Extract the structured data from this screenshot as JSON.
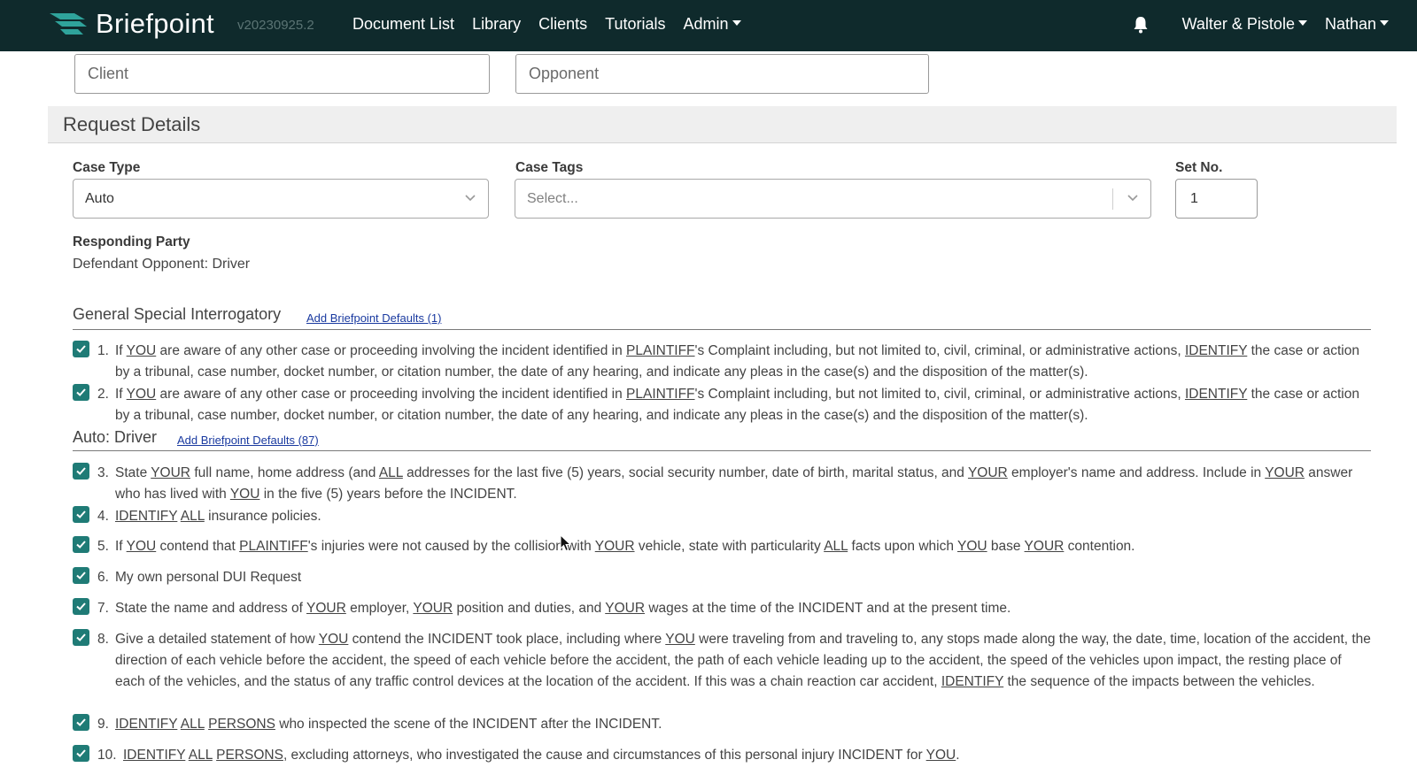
{
  "app": {
    "brand_name": "Briefpoint",
    "version": "v20230925.2",
    "nav_links": [
      "Document List",
      "Library",
      "Clients",
      "Tutorials"
    ],
    "admin_label": "Admin",
    "firm_label": "Walter & Pistole",
    "user_label": "Nathan",
    "accent_color": "#1f7b76",
    "navbar_color": "#0f2a2c"
  },
  "top_fields": {
    "client_placeholder": "Client",
    "opponent_placeholder": "Opponent"
  },
  "request_details": {
    "title": "Request Details",
    "case_type_label": "Case Type",
    "case_type_value": "Auto",
    "case_tags_label": "Case Tags",
    "case_tags_placeholder": "Select...",
    "set_no_label": "Set No.",
    "set_no_value": "1",
    "responding_party_label": "Responding Party",
    "responding_party_value": "Defendant Opponent: Driver"
  },
  "groups": [
    {
      "heading": "General Special Interrogatory",
      "add_defaults": "Add Briefpoint Defaults (1)"
    },
    {
      "heading": "Auto: Driver",
      "add_defaults": "Add Briefpoint Defaults (87)"
    }
  ],
  "items": [
    {
      "num": "1.",
      "html": "If <u>YOU</u> are aware of any other case or proceeding involving the incident identified in <u>PLAINTIFF</u>'s Complaint including, but not limited to, civil, criminal, or administrative actions, <u>IDENTIFY</u> the case or action by a tribunal, case number, docket number, or citation number, the date of any hearing, and indicate any pleas in the case(s) and the disposition of the matter(s)."
    },
    {
      "num": "2.",
      "html": "If <u>YOU</u> are aware of any other case or proceeding involving the incident identified in <u>PLAINTIFF</u>'s Complaint including, but not limited to, civil, criminal, or administrative actions, <u>IDENTIFY</u> the case or action by a tribunal, case number, docket number, or citation number, the date of any hearing, and indicate any pleas in the case(s) and the disposition of the matter(s)."
    },
    {
      "num": "3.",
      "html": "State <u>YOUR</u> full name, home address (and <u>ALL</u> addresses for the last five (5) years, social security number, date of birth, marital status, and <u>YOUR</u> employer's name and address. Include in <u>YOUR</u> answer who has lived with <u>YOU</u> in the five (5) years before the INCIDENT."
    },
    {
      "num": "4.",
      "html": "<u>IDENTIFY</u> <u>ALL</u> insurance policies."
    },
    {
      "num": "5.",
      "html": "If <u>YOU</u> contend that <u>PLAINTIFF</u>'s injuries were not caused by the collision with <u>YOUR</u> vehicle, state with particularity <u>ALL</u> facts upon which <u>YOU</u> base <u>YOUR</u> contention."
    },
    {
      "num": "6.",
      "html": "My own personal DUI Request"
    },
    {
      "num": "7.",
      "html": "State the name and address of <u>YOUR</u> employer, <u>YOUR</u> position and duties, and <u>YOUR</u> wages at the time of the INCIDENT and at the present time."
    },
    {
      "num": "8.",
      "html": "Give a detailed statement of how <u>YOU</u> contend the INCIDENT took place, including where <u>YOU</u> were traveling from and traveling to, any stops made along the way, the date, time, location of the accident, the direction of each vehicle before the accident, the speed of each vehicle before the accident, the path of each vehicle leading up to the accident, the speed of the vehicles upon impact, the resting place of each of the vehicles, and the status of any traffic control devices at the location of the accident. If this was a chain reaction car accident, <u>IDENTIFY</u> the sequence of the impacts between the vehicles."
    },
    {
      "num": "9.",
      "html": "<u>IDENTIFY</u> <u>ALL</u> <u>PERSONS</u> who inspected the scene of the INCIDENT after the INCIDENT."
    },
    {
      "num": "10.",
      "html": "<u>IDENTIFY</u> <u>ALL</u> <u>PERSONS</u>, excluding attorneys, who investigated the cause and circumstances of this personal injury INCIDENT for <u>YOU</u>."
    }
  ]
}
